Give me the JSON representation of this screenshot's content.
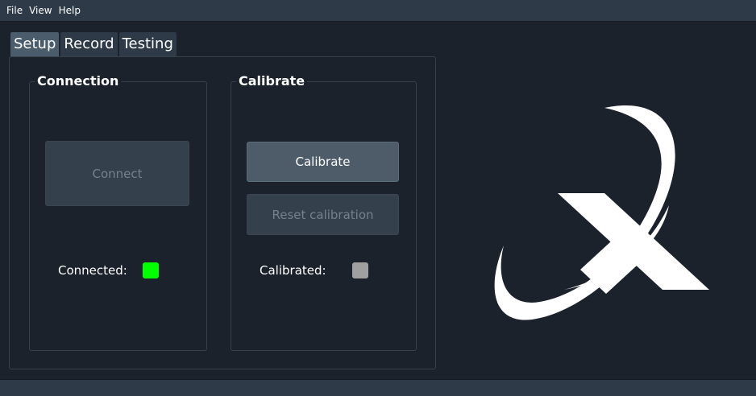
{
  "menu": {
    "file": "File",
    "view": "View",
    "help": "Help"
  },
  "tabs": [
    {
      "label": "Setup",
      "active": true
    },
    {
      "label": "Record",
      "active": false
    },
    {
      "label": "Testing",
      "active": false
    }
  ],
  "connection": {
    "title": "Connection",
    "connect_label": "Connect",
    "connect_enabled": false,
    "status_label": "Connected:",
    "status_color": "#00ff00"
  },
  "calibrate": {
    "title": "Calibrate",
    "calibrate_label": "Calibrate",
    "calibrate_enabled": true,
    "reset_label": "Reset calibration",
    "reset_enabled": false,
    "status_label": "Calibrated:",
    "status_color": "#a0a0a0"
  },
  "colors": {
    "background": "#1b222c",
    "bar": "#2e3a47",
    "active_tab": "#4b5c6c",
    "logo": "#ffffff"
  },
  "logo": {
    "icon": "x-swoosh-logo-icon"
  }
}
